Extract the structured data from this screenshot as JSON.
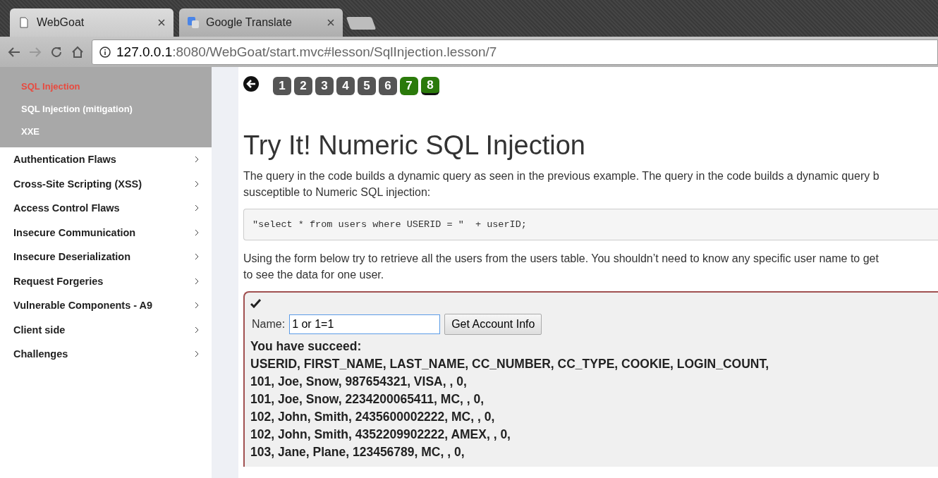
{
  "browser": {
    "tabs": [
      {
        "title": "WebGoat",
        "kind": "page",
        "selected": true
      },
      {
        "title": "Google Translate",
        "kind": "translate",
        "selected": false
      }
    ],
    "address": {
      "host": "127.0.0.1",
      "rest": ":8080/WebGoat/start.mvc#lesson/SqlInjection.lesson/7"
    }
  },
  "sidebar": {
    "subitems": [
      {
        "label": "SQL Injection",
        "selected": true
      },
      {
        "label": "SQL Injection (mitigation)",
        "selected": false
      },
      {
        "label": "XXE",
        "selected": false
      }
    ],
    "categories": [
      "Authentication Flaws",
      "Cross-Site Scripting (XSS)",
      "Access Control Flaws",
      "Insecure Communication",
      "Insecure Deserialization",
      "Request Forgeries",
      "Vulnerable Components - A9",
      "Client side",
      "Challenges"
    ]
  },
  "pages": [
    {
      "label": "1",
      "done": false,
      "selected": false
    },
    {
      "label": "2",
      "done": false,
      "selected": false
    },
    {
      "label": "3",
      "done": false,
      "selected": false
    },
    {
      "label": "4",
      "done": false,
      "selected": false
    },
    {
      "label": "5",
      "done": false,
      "selected": false
    },
    {
      "label": "6",
      "done": false,
      "selected": false
    },
    {
      "label": "7",
      "done": true,
      "selected": false
    },
    {
      "label": "8",
      "done": true,
      "selected": true
    }
  ],
  "title": "Try It! Numeric SQL Injection",
  "intro": [
    "The query in the code builds a dynamic query as seen in the previous example. The query in the code builds a dynamic query b",
    "susceptible to Numeric SQL injection:"
  ],
  "code": "\"select * from users where USERID = \"  + userID;",
  "instructions": [
    "Using the form below try to retrieve all the users from the users table. You shouldn’t need to know any specific user name to get",
    "to see the data for one user."
  ],
  "form": {
    "solved": true,
    "label": "Name:",
    "value": "1 or 1=1",
    "button": "Get Account Info"
  },
  "result": {
    "heading": "You have succeed:",
    "lines": [
      "USERID, FIRST_NAME, LAST_NAME, CC_NUMBER, CC_TYPE, COOKIE, LOGIN_COUNT,",
      "101, Joe, Snow, 987654321, VISA, , 0,",
      "101, Joe, Snow, 2234200065411, MC, , 0,",
      "102, John, Smith, 2435600002222, MC, , 0,",
      "102, John, Smith, 4352209902222, AMEX, , 0,",
      "103, Jane, Plane, 123456789, MC, , 0,"
    ]
  }
}
